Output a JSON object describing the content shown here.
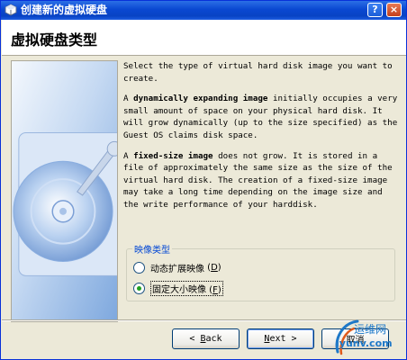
{
  "window": {
    "title": "创建新的虚拟硬盘",
    "help_label": "?",
    "close_label": "×"
  },
  "header": {
    "title": "虚拟硬盘类型"
  },
  "body": {
    "intro": "Select the type of virtual hard disk image you want to create.",
    "dynamic_prefix": "A ",
    "dynamic_term": "dynamically expanding image",
    "dynamic_text": " initially occupies a very small amount of space on your physical hard disk. It will grow dynamically (up to the size specified) as the Guest OS claims disk space.",
    "fixed_prefix": "A ",
    "fixed_term": "fixed-size image",
    "fixed_text": " does not grow. It is stored in a file of approximately the same size as the size of the virtual hard disk. The creation of a fixed-size image may take a long time depending on the image size and the write performance of your harddisk."
  },
  "image_type": {
    "legend": "映像类型",
    "options": [
      {
        "label": "动态扩展映像",
        "shortcut": "D",
        "selected": false
      },
      {
        "label": "固定大小映像",
        "shortcut": "F",
        "selected": true
      }
    ]
  },
  "buttons": {
    "back_mnemonic": "B",
    "back_rest": "ack",
    "next_mnemonic": "N",
    "next_rest": "ext",
    "cancel": "取消"
  },
  "watermark": {
    "name": "运维网",
    "url": "iyunv.com"
  },
  "colors": {
    "titlebar": "#0a48d1",
    "legend": "#0046d5",
    "radio_dot": "#21a121",
    "watermark": "#1e78c8"
  }
}
